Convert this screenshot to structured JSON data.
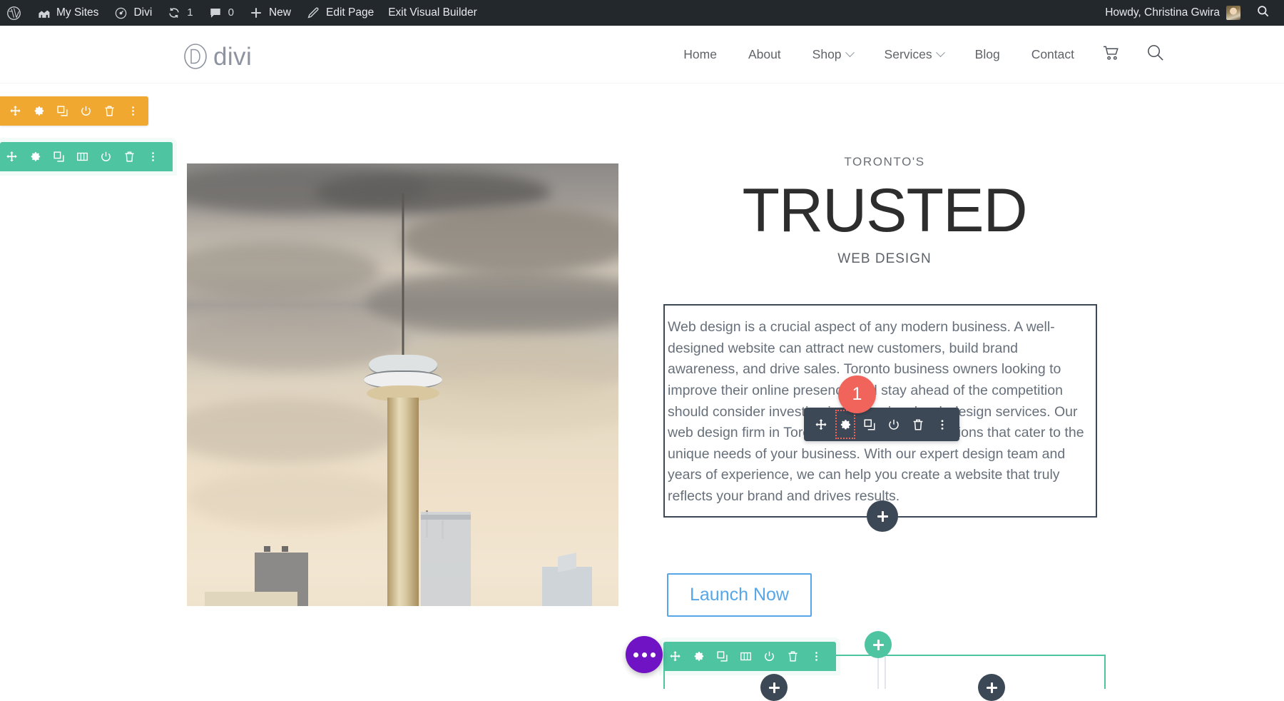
{
  "adminbar": {
    "items": [
      {
        "icon": "wordpress-icon",
        "label": ""
      },
      {
        "icon": "my-sites-icon",
        "label": "My Sites"
      },
      {
        "icon": "divi-icon",
        "label": "Divi"
      },
      {
        "icon": "updates-icon",
        "label": "1"
      },
      {
        "icon": "comments-icon",
        "label": "0"
      },
      {
        "icon": "new-icon",
        "label": "New"
      },
      {
        "icon": "edit-icon",
        "label": "Edit Page"
      },
      {
        "icon": "",
        "label": "Exit Visual Builder"
      }
    ],
    "howdy": "Howdy, Christina Gwira",
    "search_icon": "search-icon"
  },
  "siteheader": {
    "logo_text": "divi",
    "logo_icon": "divi-logo-icon",
    "nav": [
      {
        "label": "Home",
        "has_caret": false
      },
      {
        "label": "About",
        "has_caret": false
      },
      {
        "label": "Shop",
        "has_caret": true
      },
      {
        "label": "Services",
        "has_caret": true
      },
      {
        "label": "Blog",
        "has_caret": false
      },
      {
        "label": "Contact",
        "has_caret": false
      }
    ],
    "cart_icon": "cart-icon",
    "search_icon": "search-icon"
  },
  "builder": {
    "section_toolbar": {
      "color": "#f0a830",
      "buttons": [
        "move-icon",
        "gear-icon",
        "duplicate-icon",
        "power-icon",
        "trash-icon",
        "dots-icon"
      ]
    },
    "row_toolbar_top": {
      "color": "#4fc4a0",
      "buttons": [
        "move-icon",
        "gear-icon",
        "duplicate-icon",
        "columns-icon",
        "power-icon",
        "trash-icon",
        "dots-icon"
      ]
    },
    "row_toolbar_bottom": {
      "color": "#4fc4a0",
      "buttons": [
        "move-icon",
        "gear-icon",
        "duplicate-icon",
        "columns-icon",
        "power-icon",
        "trash-icon",
        "dots-icon"
      ]
    },
    "module_toolbar": {
      "color": "#3c4856",
      "active_index": 1,
      "active_outline_color": "#f0645c",
      "buttons": [
        "move-icon",
        "gear-icon",
        "duplicate-icon",
        "power-icon",
        "trash-icon",
        "dots-icon"
      ]
    },
    "badge": {
      "number": "1",
      "color": "#f0645c"
    },
    "purple_fab": {
      "icon": "ellipsis-icon",
      "color": "#7013c4"
    },
    "add_buttons": {
      "row_plus": "plus-icon",
      "module_plus_left": "plus-icon",
      "module_plus_right": "plus-icon",
      "inline_plus": "plus-icon"
    }
  },
  "hero": {
    "image_alt": "toronto-cn-tower-skyline",
    "eyebrow": "TORONTO'S",
    "title": "TRUSTED",
    "subtitle": "WEB DESIGN",
    "body": "Web design is a crucial aspect of any modern business. A well-designed website can attract new customers, build brand awareness, and drive sales. Toronto business owners looking to improve their online presence and stay ahead of the competition should consider investing in professional web design services. Our web design firm in Toronto offers bespoke solutions that cater to the unique needs of your business. With our expert design team and years of experience, we can help you create a website that truly reflects your brand and drives results.",
    "cta_label": "Launch Now",
    "cta_color": "#56a6e8"
  }
}
